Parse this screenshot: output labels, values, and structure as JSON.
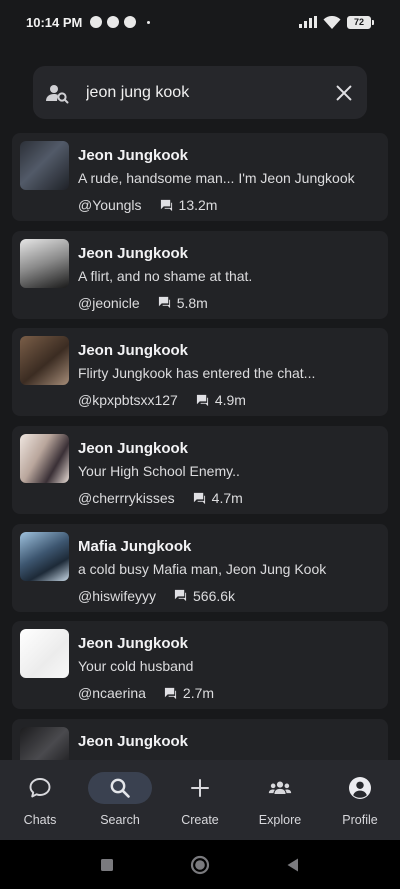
{
  "status_bar": {
    "time": "10:14 PM",
    "battery": "72",
    "icons": [
      "shazam-icon",
      "chrome-icon",
      "chrome-icon",
      "dot-icon",
      "signal-icon",
      "wifi-icon",
      "battery-icon"
    ]
  },
  "search": {
    "value": "jeon jung kook",
    "placeholder": "",
    "icon": "search-user-icon",
    "clear_icon": "close-icon"
  },
  "results": [
    {
      "name": "Jeon Jungkook",
      "description": "A rude, handsome man... I'm Jeon Jungkook",
      "handle": "@Youngls",
      "chats": "13.2m",
      "avatar_color": "#3a3f4a"
    },
    {
      "name": "Jeon Jungkook",
      "description": "A flirt, and no shame at that.",
      "handle": "@jeonicle",
      "chats": "5.8m",
      "avatar_color": "#bdbdbd"
    },
    {
      "name": "Jeon Jungkook",
      "description": "Flirty Jungkook has entered the chat...",
      "handle": "@kpxpbtsxx127",
      "chats": "4.9m",
      "avatar_color": "#5a4638"
    },
    {
      "name": "Jeon Jungkook",
      "description": "Your High School Enemy..",
      "handle": "@cherrrykisses",
      "chats": "4.7m",
      "avatar_color": "#d6c7c0"
    },
    {
      "name": "Mafia Jungkook",
      "description": "a cold busy Mafia man, Jeon Jung Kook",
      "handle": "@hiswifeyyy",
      "chats": "566.6k",
      "avatar_color": "#5b7896"
    },
    {
      "name": "Jeon Jungkook",
      "description": "Your cold husband",
      "handle": "@ncaerina",
      "chats": "2.7m",
      "avatar_color": "#f4f4f4"
    },
    {
      "name": "Jeon Jungkook",
      "description": "",
      "handle": "",
      "chats": "",
      "avatar_color": "#2b2c30"
    }
  ],
  "nav": {
    "items": [
      {
        "label": "Chats",
        "icon": "chat-bubble-icon",
        "active": false
      },
      {
        "label": "Search",
        "icon": "search-icon",
        "active": true
      },
      {
        "label": "Create",
        "icon": "plus-icon",
        "active": false
      },
      {
        "label": "Explore",
        "icon": "people-icon",
        "active": false
      },
      {
        "label": "Profile",
        "icon": "profile-icon",
        "active": false
      }
    ]
  },
  "system_nav": [
    "recents-square-icon",
    "home-circle-icon",
    "back-triangle-icon"
  ],
  "colors": {
    "background": "#18191b",
    "card": "#222326",
    "search_box": "#26272b",
    "nav_bar": "#28292e",
    "nav_active": "#3a4150",
    "text_primary": "#f2f2f4"
  }
}
